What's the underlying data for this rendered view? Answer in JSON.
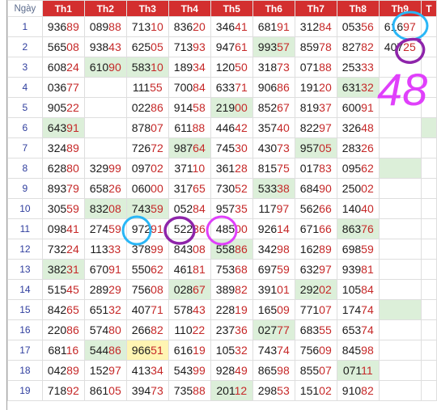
{
  "table": {
    "headers": [
      "Ngày",
      "Th1",
      "Th2",
      "Th3",
      "Th4",
      "Th5",
      "Th6",
      "Th7",
      "Th8",
      "Th9",
      "T"
    ],
    "rows": [
      {
        "day": "1",
        "cells": [
          {
            "h": "936",
            "t": "89"
          },
          {
            "h": "089",
            "t": "88"
          },
          {
            "h": "713",
            "t": "10"
          },
          {
            "h": "836",
            "t": "20"
          },
          {
            "h": "346",
            "t": "41"
          },
          {
            "h": "681",
            "t": "91"
          },
          {
            "h": "312",
            "t": "84"
          },
          {
            "h": "053",
            "t": "56"
          },
          {
            "h": "616",
            "t": "97"
          },
          {
            "h": "",
            "t": ""
          }
        ]
      },
      {
        "day": "2",
        "cells": [
          {
            "h": "565",
            "t": "08"
          },
          {
            "h": "938",
            "t": "43"
          },
          {
            "h": "625",
            "t": "05"
          },
          {
            "h": "713",
            "t": "93"
          },
          {
            "h": "947",
            "t": "61"
          },
          {
            "h": "993",
            "t": "57",
            "g": true
          },
          {
            "h": "859",
            "t": "78"
          },
          {
            "h": "827",
            "t": "82"
          },
          {
            "h": "407",
            "t": "25"
          },
          {
            "h": "",
            "t": ""
          }
        ]
      },
      {
        "day": "3",
        "cells": [
          {
            "h": "608",
            "t": "24"
          },
          {
            "h": "610",
            "t": "90",
            "g": true
          },
          {
            "h": "583",
            "t": "10",
            "g": true
          },
          {
            "h": "189",
            "t": "34"
          },
          {
            "h": "120",
            "t": "50"
          },
          {
            "h": "318",
            "t": "73"
          },
          {
            "h": "071",
            "t": "88"
          },
          {
            "h": "253",
            "t": "33"
          },
          {
            "h": "",
            "t": ""
          },
          {
            "h": "",
            "t": ""
          }
        ]
      },
      {
        "day": "4",
        "cells": [
          {
            "h": "036",
            "t": "77"
          },
          {
            "h": "",
            "t": ""
          },
          {
            "h": "111",
            "t": "55"
          },
          {
            "h": "700",
            "t": "84"
          },
          {
            "h": "633",
            "t": "71"
          },
          {
            "h": "906",
            "t": "86"
          },
          {
            "h": "191",
            "t": "20"
          },
          {
            "h": "631",
            "t": "32",
            "g": true
          },
          {
            "h": "",
            "t": ""
          },
          {
            "h": "",
            "t": ""
          }
        ]
      },
      {
        "day": "5",
        "cells": [
          {
            "h": "905",
            "t": "22"
          },
          {
            "h": "",
            "t": ""
          },
          {
            "h": "022",
            "t": "86"
          },
          {
            "h": "914",
            "t": "58"
          },
          {
            "h": "219",
            "t": "00",
            "g": true
          },
          {
            "h": "852",
            "t": "67"
          },
          {
            "h": "819",
            "t": "37"
          },
          {
            "h": "600",
            "t": "91"
          },
          {
            "h": "",
            "t": ""
          },
          {
            "h": "",
            "t": ""
          }
        ]
      },
      {
        "day": "6",
        "cells": [
          {
            "h": "643",
            "t": "91",
            "g": true
          },
          {
            "h": "",
            "t": ""
          },
          {
            "h": "878",
            "t": "07"
          },
          {
            "h": "611",
            "t": "88"
          },
          {
            "h": "446",
            "t": "42"
          },
          {
            "h": "357",
            "t": "40"
          },
          {
            "h": "822",
            "t": "97"
          },
          {
            "h": "326",
            "t": "48"
          },
          {
            "h": "",
            "t": ""
          },
          {
            "h": "",
            "t": "",
            "g": true
          }
        ]
      },
      {
        "day": "7",
        "cells": [
          {
            "h": "324",
            "t": "89"
          },
          {
            "h": "",
            "t": ""
          },
          {
            "h": "726",
            "t": "72"
          },
          {
            "h": "987",
            "t": "64",
            "g": true
          },
          {
            "h": "745",
            "t": "30"
          },
          {
            "h": "430",
            "t": "73"
          },
          {
            "h": "957",
            "t": "05",
            "g": true
          },
          {
            "h": "283",
            "t": "26"
          },
          {
            "h": "",
            "t": ""
          },
          {
            "h": "",
            "t": ""
          }
        ]
      },
      {
        "day": "8",
        "cells": [
          {
            "h": "628",
            "t": "80"
          },
          {
            "h": "329",
            "t": "99"
          },
          {
            "h": "097",
            "t": "02"
          },
          {
            "h": "371",
            "t": "10"
          },
          {
            "h": "361",
            "t": "28"
          },
          {
            "h": "815",
            "t": "75"
          },
          {
            "h": "017",
            "t": "83"
          },
          {
            "h": "095",
            "t": "62"
          },
          {
            "h": "",
            "t": "",
            "g": true
          },
          {
            "h": "",
            "t": ""
          }
        ]
      },
      {
        "day": "9",
        "cells": [
          {
            "h": "893",
            "t": "79"
          },
          {
            "h": "658",
            "t": "26"
          },
          {
            "h": "060",
            "t": "00"
          },
          {
            "h": "317",
            "t": "65"
          },
          {
            "h": "730",
            "t": "52"
          },
          {
            "h": "533",
            "t": "38",
            "g": true
          },
          {
            "h": "684",
            "t": "90"
          },
          {
            "h": "250",
            "t": "02"
          },
          {
            "h": "",
            "t": ""
          },
          {
            "h": "",
            "t": ""
          }
        ]
      },
      {
        "day": "10",
        "cells": [
          {
            "h": "305",
            "t": "59"
          },
          {
            "h": "832",
            "t": "08",
            "g": true
          },
          {
            "h": "743",
            "t": "59",
            "g": true
          },
          {
            "h": "052",
            "t": "84"
          },
          {
            "h": "957",
            "t": "35"
          },
          {
            "h": "117",
            "t": "97"
          },
          {
            "h": "562",
            "t": "66"
          },
          {
            "h": "140",
            "t": "40"
          },
          {
            "h": "",
            "t": ""
          },
          {
            "h": "",
            "t": ""
          }
        ]
      },
      {
        "day": "11",
        "cells": [
          {
            "h": "098",
            "t": "41"
          },
          {
            "h": "274",
            "t": "59"
          },
          {
            "h": "972",
            "t": "91"
          },
          {
            "h": "522",
            "t": "36"
          },
          {
            "h": "485",
            "t": "00"
          },
          {
            "h": "926",
            "t": "14"
          },
          {
            "h": "671",
            "t": "66"
          },
          {
            "h": "863",
            "t": "76",
            "g": true
          },
          {
            "h": "",
            "t": ""
          },
          {
            "h": "",
            "t": ""
          }
        ]
      },
      {
        "day": "12",
        "cells": [
          {
            "h": "732",
            "t": "24"
          },
          {
            "h": "113",
            "t": "33"
          },
          {
            "h": "378",
            "t": "99"
          },
          {
            "h": "843",
            "t": "08"
          },
          {
            "h": "558",
            "t": "86",
            "g": true
          },
          {
            "h": "342",
            "t": "98"
          },
          {
            "h": "162",
            "t": "89"
          },
          {
            "h": "698",
            "t": "59"
          },
          {
            "h": "",
            "t": ""
          },
          {
            "h": "",
            "t": ""
          }
        ]
      },
      {
        "day": "13",
        "cells": [
          {
            "h": "382",
            "t": "31",
            "g": true
          },
          {
            "h": "670",
            "t": "91"
          },
          {
            "h": "550",
            "t": "62"
          },
          {
            "h": "461",
            "t": "81"
          },
          {
            "h": "753",
            "t": "68"
          },
          {
            "h": "697",
            "t": "59"
          },
          {
            "h": "632",
            "t": "97"
          },
          {
            "h": "939",
            "t": "81"
          },
          {
            "h": "",
            "t": ""
          },
          {
            "h": "",
            "t": ""
          }
        ]
      },
      {
        "day": "14",
        "cells": [
          {
            "h": "515",
            "t": "45"
          },
          {
            "h": "289",
            "t": "29"
          },
          {
            "h": "756",
            "t": "08"
          },
          {
            "h": "028",
            "t": "67",
            "g": true
          },
          {
            "h": "389",
            "t": "82"
          },
          {
            "h": "391",
            "t": "01"
          },
          {
            "h": "292",
            "t": "02",
            "g": true
          },
          {
            "h": "105",
            "t": "84"
          },
          {
            "h": "",
            "t": ""
          },
          {
            "h": "",
            "t": ""
          }
        ]
      },
      {
        "day": "15",
        "cells": [
          {
            "h": "842",
            "t": "65"
          },
          {
            "h": "651",
            "t": "32"
          },
          {
            "h": "407",
            "t": "71"
          },
          {
            "h": "578",
            "t": "43"
          },
          {
            "h": "228",
            "t": "19"
          },
          {
            "h": "165",
            "t": "09"
          },
          {
            "h": "771",
            "t": "07"
          },
          {
            "h": "174",
            "t": "74"
          },
          {
            "h": "",
            "t": "",
            "g": true
          },
          {
            "h": "",
            "t": ""
          }
        ]
      },
      {
        "day": "16",
        "cells": [
          {
            "h": "220",
            "t": "86"
          },
          {
            "h": "574",
            "t": "80"
          },
          {
            "h": "266",
            "t": "82"
          },
          {
            "h": "110",
            "t": "22"
          },
          {
            "h": "237",
            "t": "36"
          },
          {
            "h": "027",
            "t": "77",
            "g": true
          },
          {
            "h": "683",
            "t": "55"
          },
          {
            "h": "653",
            "t": "74"
          },
          {
            "h": "",
            "t": ""
          },
          {
            "h": "",
            "t": ""
          }
        ]
      },
      {
        "day": "17",
        "cells": [
          {
            "h": "681",
            "t": "16"
          },
          {
            "h": "544",
            "t": "86",
            "g": true
          },
          {
            "h": "966",
            "t": "51",
            "y": true
          },
          {
            "h": "616",
            "t": "19"
          },
          {
            "h": "105",
            "t": "32"
          },
          {
            "h": "743",
            "t": "74"
          },
          {
            "h": "756",
            "t": "09"
          },
          {
            "h": "845",
            "t": "98"
          },
          {
            "h": "",
            "t": ""
          },
          {
            "h": "",
            "t": ""
          }
        ]
      },
      {
        "day": "18",
        "cells": [
          {
            "h": "042",
            "t": "89"
          },
          {
            "h": "152",
            "t": "97"
          },
          {
            "h": "413",
            "t": "34"
          },
          {
            "h": "543",
            "t": "99"
          },
          {
            "h": "928",
            "t": "49"
          },
          {
            "h": "865",
            "t": "98"
          },
          {
            "h": "855",
            "t": "07"
          },
          {
            "h": "071",
            "t": "11",
            "g": true
          },
          {
            "h": "",
            "t": ""
          },
          {
            "h": "",
            "t": ""
          }
        ]
      },
      {
        "day": "19",
        "cells": [
          {
            "h": "718",
            "t": "92"
          },
          {
            "h": "861",
            "t": "05"
          },
          {
            "h": "394",
            "t": "73"
          },
          {
            "h": "735",
            "t": "88"
          },
          {
            "h": "201",
            "t": "12",
            "g": true
          },
          {
            "h": "298",
            "t": "53"
          },
          {
            "h": "151",
            "t": "02"
          },
          {
            "h": "910",
            "t": "82"
          },
          {
            "h": "",
            "t": ""
          },
          {
            "h": "",
            "t": ""
          }
        ]
      }
    ]
  },
  "annotations": {
    "handwritten_number": "48",
    "colors": {
      "cyan": "#29b6f6",
      "purple": "#8e24aa",
      "magenta": "#e040fb"
    }
  },
  "colors": {
    "header_bg": "#d32f2f",
    "green_hl": "#dcefd9",
    "yellow_hl": "#fff5b3",
    "tail": "#c62828",
    "day": "#2f3e9e"
  }
}
